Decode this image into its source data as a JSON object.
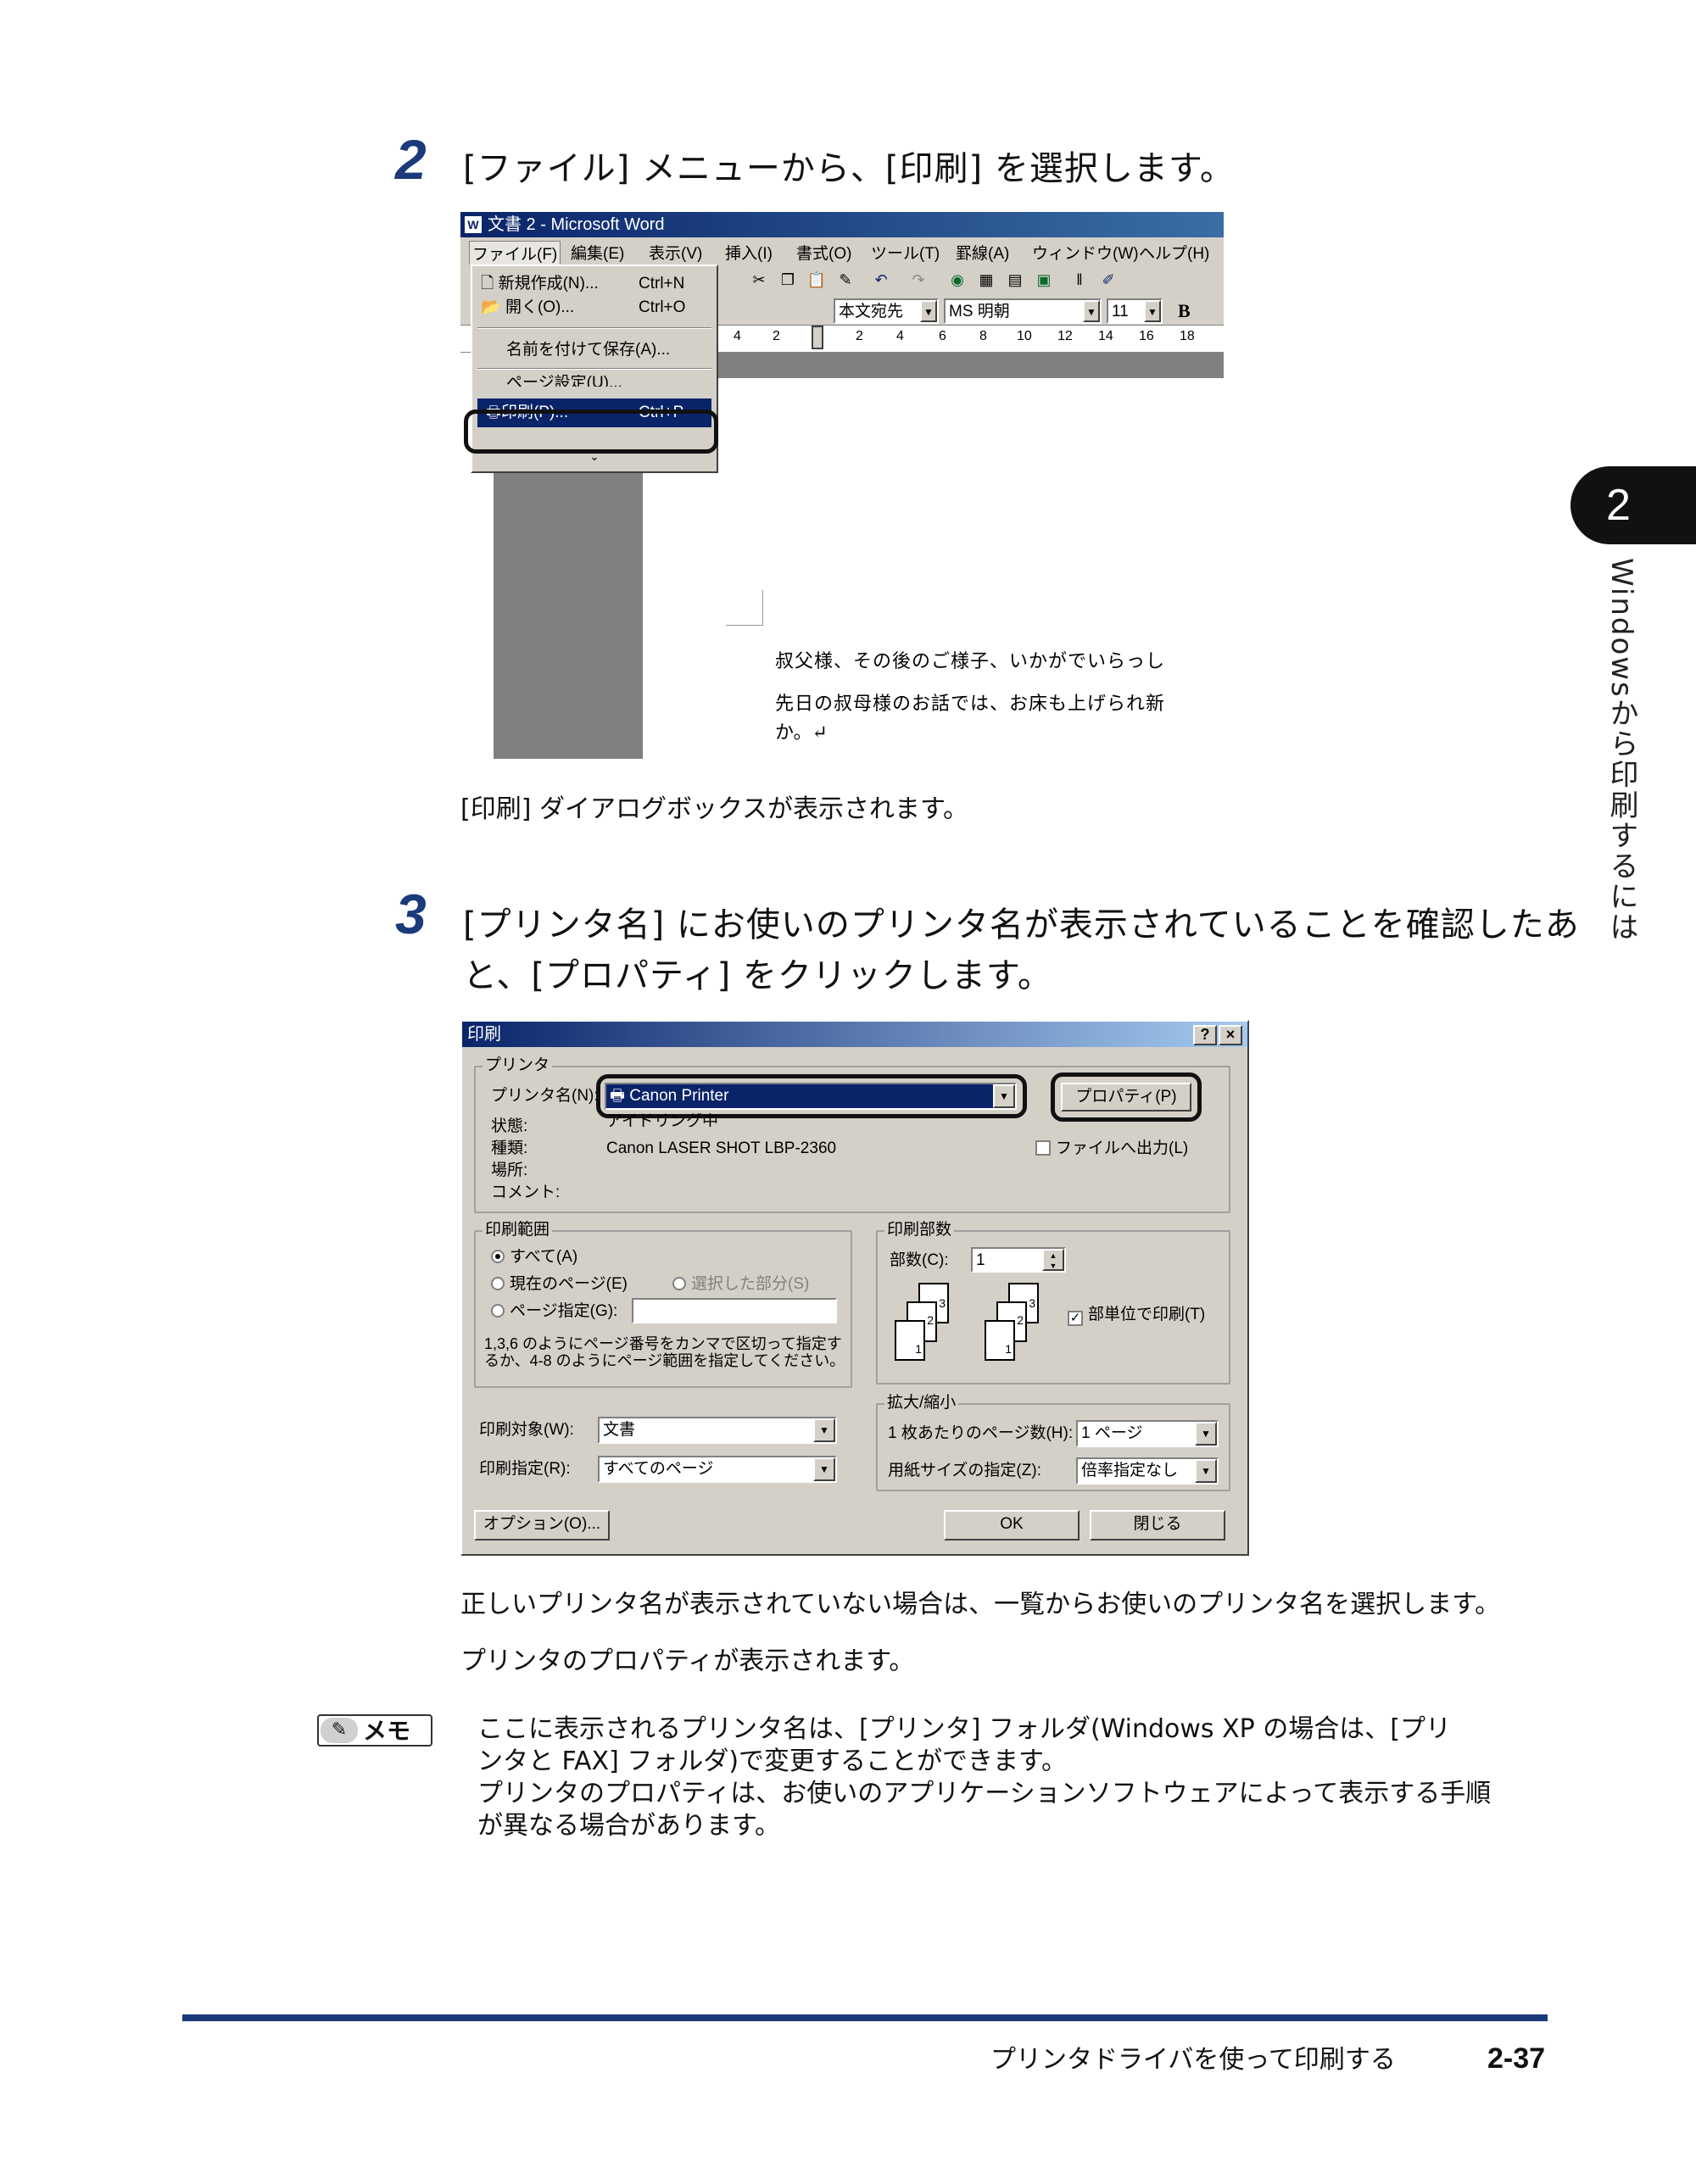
{
  "step2": {
    "number": "2",
    "text": "[ファイル] メニューから、[印刷] を選択します。",
    "result": "[印刷] ダイアログボックスが表示されます。"
  },
  "word": {
    "title": "文書 2 - Microsoft Word",
    "menus": [
      "ファイル(F)",
      "編集(E)",
      "表示(V)",
      "挿入(I)",
      "書式(O)",
      "ツール(T)",
      "罫線(A)",
      "ウィンドウ(W)",
      "ヘルプ(H)"
    ],
    "file_menu": {
      "new": "新規作成(N)...",
      "new_shortcut": "Ctrl+N",
      "open": "開く(O)...",
      "open_shortcut": "Ctrl+O",
      "save_as": "名前を付けて保存(A)...",
      "page_setup": "ページ設定(U)...",
      "print": "印刷(P)...",
      "print_shortcut": "Ctrl+P"
    },
    "style_box": "本文宛先",
    "font_box": "MS 明朝",
    "size_box": "11",
    "bold": "B",
    "ruler_ticks": [
      "4",
      "2",
      "2",
      "4",
      "6",
      "8",
      "10",
      "12",
      "14",
      "16",
      "18"
    ],
    "doc_lines": [
      "叔父様、その後のご様子、いかがでいらっし",
      "先日の叔母様のお話では、お床も上げられ新",
      "か。↵"
    ]
  },
  "step3": {
    "number": "3",
    "text_line1": "[プリンタ名] にお使いのプリンタ名が表示されていることを確認したあ",
    "text_line2": "と、[プロパティ] をクリックします。"
  },
  "dialog": {
    "title": "印刷",
    "help": "?",
    "close": "×",
    "printer_group": "プリンタ",
    "printer_name_label": "プリンタ名(N):",
    "printer_name_value": "Canon Printer",
    "properties_button": "プロパティ(P)",
    "status_label": "状態:",
    "status_value": "アイドリング中",
    "type_label": "種類:",
    "type_value": "Canon LASER SHOT LBP-2360",
    "where_label": "場所:",
    "comment_label": "コメント:",
    "print_to_file": "ファイルへ出力(L)",
    "range_group": "印刷範囲",
    "range_all": "すべて(A)",
    "range_current": "現在のページ(E)",
    "range_selection": "選択した部分(S)",
    "range_pages": "ページ指定(G):",
    "range_hint_line1": "1,3,6 のようにページ番号をカンマで区切って指定す",
    "range_hint_line2": "るか、4-8 のようにページ範囲を指定してください。",
    "copies_group": "印刷部数",
    "copies_label": "部数(C):",
    "copies_value": "1",
    "collate": "部単位で印刷(T)",
    "collate_pages": [
      "1",
      "2",
      "3"
    ],
    "print_what_label": "印刷対象(W):",
    "print_what_value": "文書",
    "print_label": "印刷指定(R):",
    "print_value": "すべてのページ",
    "zoom_group": "拡大/縮小",
    "pages_per_sheet_label": "1 枚あたりのページ数(H):",
    "pages_per_sheet_value": "1 ページ",
    "scale_label": "用紙サイズの指定(Z):",
    "scale_value": "倍率指定なし",
    "options_button": "オプション(O)...",
    "ok_button": "OK",
    "cancel_button": "閉じる"
  },
  "after": {
    "line1": "正しいプリンタ名が表示されていない場合は、一覧からお使いのプリンタ名を選択します。",
    "line2": "プリンタのプロパティが表示されます。"
  },
  "memo": {
    "label": "メモ",
    "line1": "ここに表示されるプリンタ名は、[プリンタ] フォルダ(Windows XP の場合は、[プリ",
    "line2": "ンタと FAX] フォルダ)で変更することができます。",
    "line3": "プリンタのプロパティは、お使いのアプリケーションソフトウェアによって表示する手順",
    "line4": "が異なる場合があります。"
  },
  "side_tab": {
    "number": "2",
    "text": "Windowsから印刷するには"
  },
  "footer": {
    "title": "プリンタドライバを使って印刷する",
    "page": "2-37"
  },
  "colors": {
    "accent": "#1a3a7a",
    "titlebar": "#0a246a",
    "dialog_gray": "#d4d0c8"
  }
}
